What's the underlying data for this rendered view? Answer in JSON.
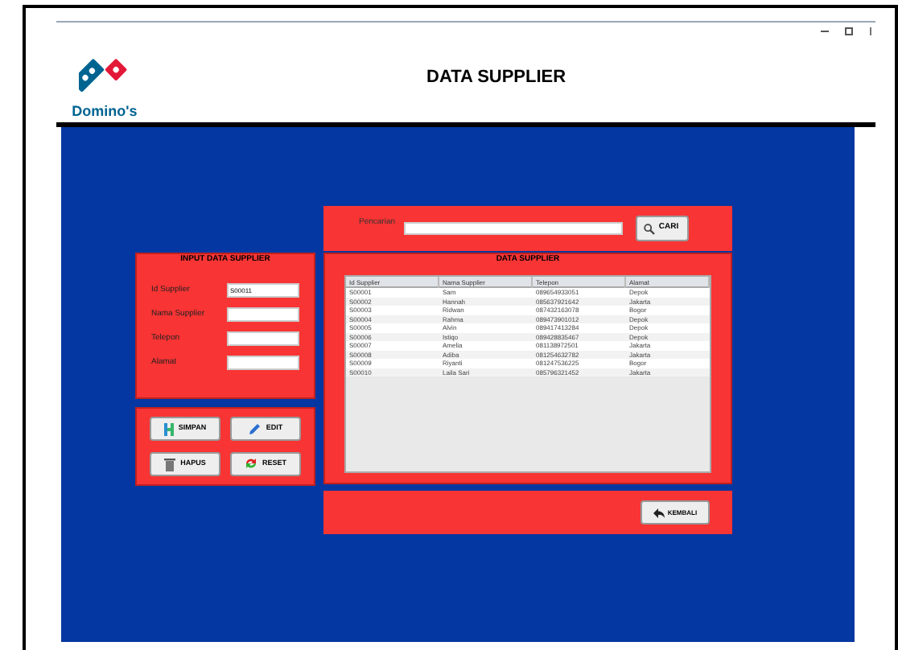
{
  "logo": {
    "text": "Domino's"
  },
  "title": "DATA SUPPLIER",
  "input_panel": {
    "title": "INPUT DATA SUPPLIER",
    "fields": [
      {
        "label": "Id Supplier",
        "value": "S00011"
      },
      {
        "label": "Nama Supplier"
      },
      {
        "label": "Telepon"
      },
      {
        "label": "Alamat"
      }
    ]
  },
  "actions": [
    {
      "label": "SIMPAN",
      "kind": "save"
    },
    {
      "label": "EDIT",
      "kind": "edit"
    },
    {
      "label": "HAPUS",
      "kind": "delete"
    },
    {
      "label": "RESET",
      "kind": "reset"
    }
  ],
  "search": {
    "label": "Pencarian",
    "button": "CARI"
  },
  "table": {
    "title": "DATA SUPPLIER",
    "columns": [
      "Id Supplier",
      "Nama Supplier",
      "Telepon",
      "Alamat"
    ],
    "rows": [
      [
        "S00001",
        "Sam",
        "089654933051",
        "Depok"
      ],
      [
        "S00002",
        "Hannah",
        "085637921642",
        "Jakarta"
      ],
      [
        "S00003",
        "Ridwan",
        "087432163078",
        "Bogor"
      ],
      [
        "S00004",
        "Rahma",
        "089473901012",
        "Depok"
      ],
      [
        "S00005",
        "Alvin",
        "089417413284",
        "Depok"
      ],
      [
        "S00006",
        "Istiqo",
        "089428835467",
        "Depok"
      ],
      [
        "S00007",
        "Amelia",
        "081138972501",
        "Jakarta"
      ],
      [
        "S00008",
        "Adiba",
        "081254632782",
        "Jakarta"
      ],
      [
        "S00009",
        "Riyanti",
        "081247536225",
        "Bogor"
      ],
      [
        "S00010",
        "Laila Sari",
        "085796321452",
        "Jakarta"
      ]
    ]
  },
  "back_button": "KEMBALI"
}
